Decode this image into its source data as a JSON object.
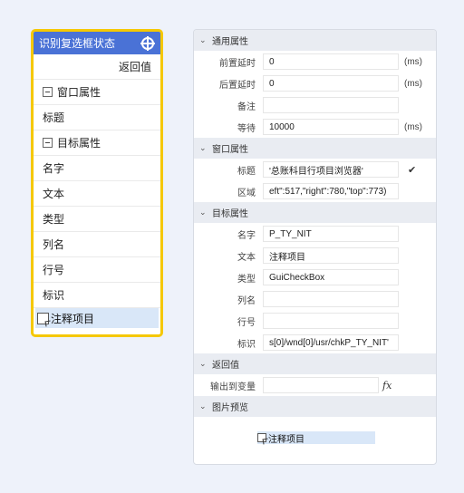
{
  "node": {
    "title": "识别复选框状态",
    "return_label": "返回值",
    "window_group": "窗口属性",
    "title_label": "标题",
    "target_group": "目标属性",
    "rows": [
      "名字",
      "文本",
      "类型",
      "列名",
      "行号",
      "标识"
    ],
    "preview_text": "注释项目",
    "colors": {
      "header": "#4a72d6",
      "border": "#f5c800"
    }
  },
  "panel": {
    "general": {
      "header": "通用属性",
      "pre_delay_label": "前置延时",
      "pre_delay_value": "0",
      "pre_delay_unit": "(ms)",
      "post_delay_label": "后置延时",
      "post_delay_value": "0",
      "post_delay_unit": "(ms)",
      "note_label": "备注",
      "note_value": "",
      "wait_label": "等待",
      "wait_value": "10000",
      "wait_unit": "(ms)"
    },
    "window": {
      "header": "窗口属性",
      "title_label": "标题",
      "title_value": "'总账科目行项目浏览器'",
      "region_label": "区域",
      "region_value": "eft\":517,\"right\":780,\"top\":773)"
    },
    "target": {
      "header": "目标属性",
      "name_label": "名字",
      "name_value": "P_TY_NIT",
      "text_label": "文本",
      "text_value": "注释项目",
      "type_label": "类型",
      "type_value": "GuiCheckBox",
      "col_label": "列名",
      "col_value": "",
      "row_label": "行号",
      "row_value": "",
      "id_label": "标识",
      "id_value": "s[0]/wnd[0]/usr/chkP_TY_NIT'"
    },
    "return": {
      "header": "返回值",
      "output_label": "输出到变量",
      "output_value": "",
      "fx": "fx"
    },
    "preview": {
      "header": "图片预览",
      "text": "注释项目"
    }
  }
}
